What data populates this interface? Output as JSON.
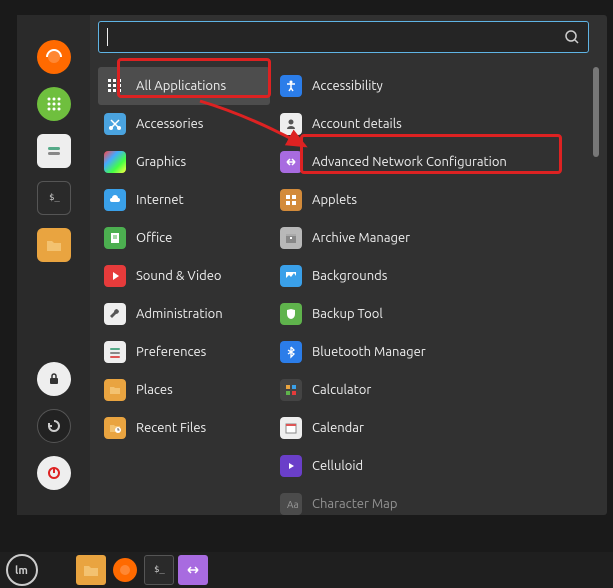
{
  "search": {
    "placeholder": ""
  },
  "favorites": [
    {
      "name": "firefox",
      "bg": "#ff6a00",
      "glyph": "firefox"
    },
    {
      "name": "apps-grid",
      "bg": "#6fbf3e",
      "glyph": "grid"
    },
    {
      "name": "settings-toggle",
      "bg": "#eee",
      "glyph": "toggle"
    },
    {
      "name": "terminal",
      "bg": "#2a2a2a",
      "glyph": "terminal"
    },
    {
      "name": "files",
      "bg": "#e9a440",
      "glyph": "folder"
    }
  ],
  "favorites_bottom": [
    {
      "name": "lock",
      "bg": "#eee",
      "glyph": "lock"
    },
    {
      "name": "logout",
      "bg": "#222",
      "glyph": "refresh"
    },
    {
      "name": "power",
      "bg": "#eee",
      "glyph": "power"
    }
  ],
  "categories": [
    {
      "icon": "grid-white",
      "label": "All Applications",
      "selected": true
    },
    {
      "icon": "scissors",
      "label": "Accessories",
      "bg": "#4aa3df"
    },
    {
      "icon": "palette",
      "label": "Graphics",
      "bg": "linear"
    },
    {
      "icon": "cloud",
      "label": "Internet",
      "bg": "#3aa0e9"
    },
    {
      "icon": "doc",
      "label": "Office",
      "bg": "#4caf50"
    },
    {
      "icon": "play",
      "label": "Sound & Video",
      "bg": "#e63b3b"
    },
    {
      "icon": "wrench",
      "label": "Administration",
      "bg": "#eee"
    },
    {
      "icon": "sliders",
      "label": "Preferences",
      "bg": "#eee"
    },
    {
      "icon": "folder",
      "label": "Places",
      "bg": "#e9a440"
    },
    {
      "icon": "clock",
      "label": "Recent Files",
      "bg": "#e9a440"
    }
  ],
  "apps": [
    {
      "icon": "accessibility",
      "label": "Accessibility",
      "bg": "#2b7de9"
    },
    {
      "icon": "person",
      "label": "Account details",
      "bg": "#eee"
    },
    {
      "icon": "network",
      "label": "Advanced Network Configuration",
      "bg": "#a86be0",
      "highlighted": true
    },
    {
      "icon": "grid4",
      "label": "Applets",
      "bg": "#d38b3a"
    },
    {
      "icon": "archive",
      "label": "Archive Manager",
      "bg": "#b8b8b8"
    },
    {
      "icon": "image",
      "label": "Backgrounds",
      "bg": "#3aa0e9"
    },
    {
      "icon": "shield",
      "label": "Backup Tool",
      "bg": "#5fb34c"
    },
    {
      "icon": "bluetooth",
      "label": "Bluetooth Manager",
      "bg": "#2b7de9"
    },
    {
      "icon": "calc",
      "label": "Calculator",
      "bg": "#444"
    },
    {
      "icon": "calendar",
      "label": "Calendar",
      "bg": "#eee"
    },
    {
      "icon": "media",
      "label": "Celluloid",
      "bg": "#6a3fc9"
    },
    {
      "icon": "charmap",
      "label": "Character Map",
      "bg": "#666"
    }
  ],
  "taskbar": [
    {
      "name": "files",
      "bg": "#e9a440"
    },
    {
      "name": "firefox",
      "bg": "#ff6a00"
    },
    {
      "name": "terminal",
      "bg": "#2a2a2a"
    },
    {
      "name": "network-config",
      "bg": "#a86be0"
    }
  ]
}
